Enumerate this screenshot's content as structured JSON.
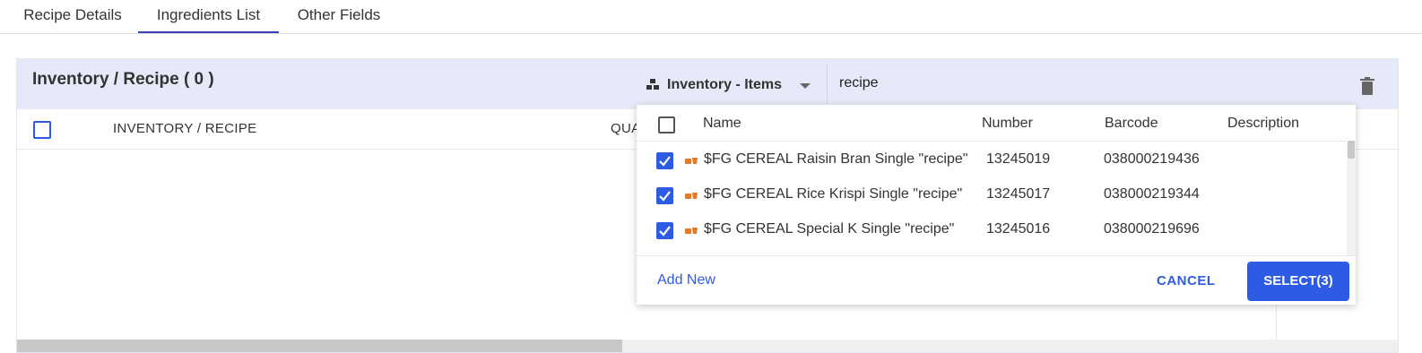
{
  "tabs": [
    {
      "label": "Recipe Details",
      "active": false
    },
    {
      "label": "Ingredients List",
      "active": true
    },
    {
      "label": "Other Fields",
      "active": false
    }
  ],
  "panel": {
    "title": "Inventory / Recipe ( 0 )",
    "columns": [
      "INVENTORY / RECIPE",
      "QUA"
    ]
  },
  "search": {
    "source_label": "Inventory - Items",
    "query": "recipe"
  },
  "dropdown": {
    "columns": [
      "Name",
      "Number",
      "Barcode",
      "Description"
    ],
    "rows": [
      {
        "name": "$FG CEREAL Raisin Bran Single \"recipe\"",
        "number": "13245019",
        "barcode": "038000219436",
        "description": "",
        "checked": true
      },
      {
        "name": "$FG CEREAL Rice Krispi Single \"recipe\"",
        "number": "13245017",
        "barcode": "038000219344",
        "description": "",
        "checked": true
      },
      {
        "name": "$FG CEREAL Special K Single \"recipe\"",
        "number": "13245016",
        "barcode": "038000219696",
        "description": "",
        "checked": true
      }
    ],
    "add_new_label": "Add New",
    "cancel_label": "CANCEL",
    "select_label": "SELECT(3)"
  },
  "colors": {
    "accent": "#2d5be3",
    "header_bg": "#e6e9f7",
    "item_icon": "#e07b2c"
  }
}
